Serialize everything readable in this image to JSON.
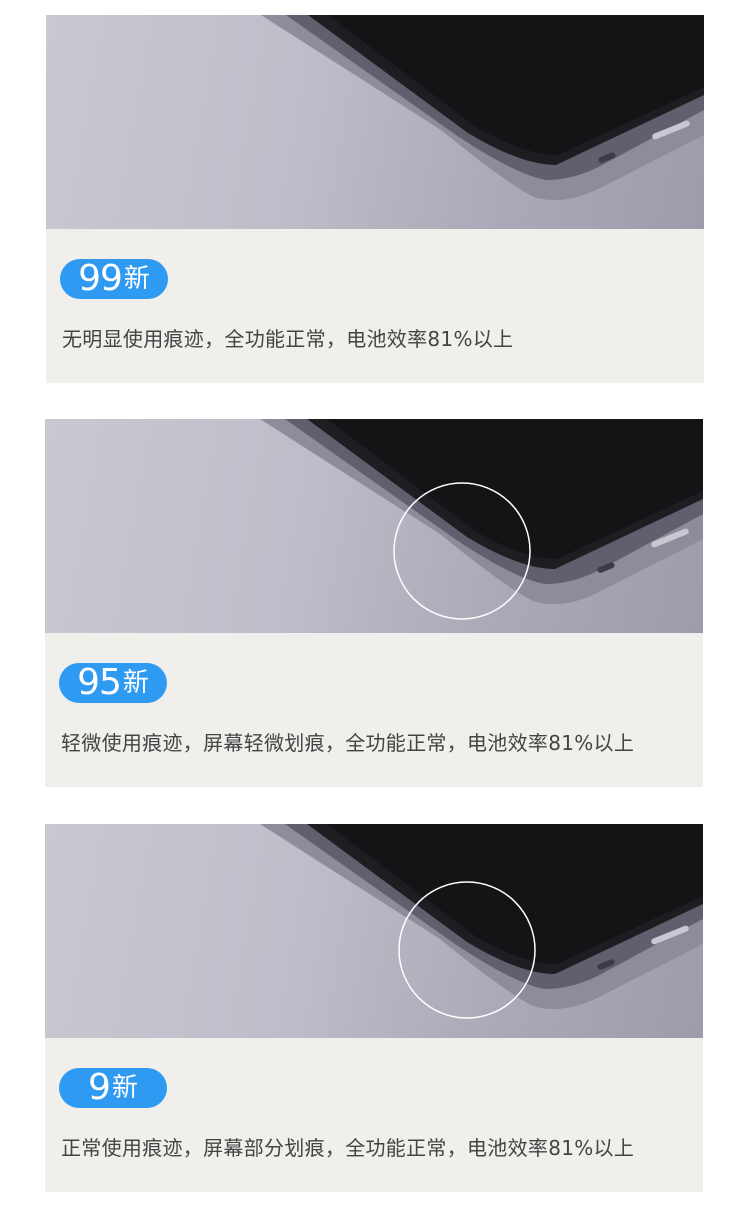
{
  "grades": [
    {
      "number": "99",
      "suffix": "新",
      "description": "无明显使用痕迹，全功能正常，电池效率81%以上"
    },
    {
      "number": "95",
      "suffix": "新",
      "description": "轻微使用痕迹，屏幕轻微划痕，全功能正常，电池效率81%以上"
    },
    {
      "number": "9",
      "suffix": "新",
      "description": "正常使用痕迹，屏幕部分划痕，全功能正常，电池效率81%以上"
    }
  ],
  "colors": {
    "badge": "#2f9af2",
    "info_bg": "#f1efec",
    "text": "#444444"
  }
}
